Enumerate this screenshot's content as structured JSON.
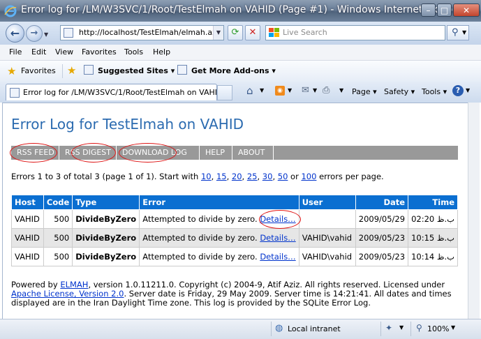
{
  "window": {
    "title": "Error log for /LM/W3SVC/1/Root/TestElmah on VAHID (Page #1) - Windows Internet Explorer",
    "min_label": "–",
    "max_label": "□",
    "close_label": "✕"
  },
  "address": {
    "url": "http://localhost/TestElmah/elmah.axd",
    "search_placeholder": "Live Search"
  },
  "menu": [
    "File",
    "Edit",
    "View",
    "Favorites",
    "Tools",
    "Help"
  ],
  "favorites": {
    "favorites_label": "Favorites",
    "suggested_label": "Suggested Sites ▾",
    "addons_label": "Get More Add-ons ▾"
  },
  "tab": {
    "title": "Error log for /LM/W3SVC/1/Root/TestElmah on VAHI..."
  },
  "commands": {
    "page": "Page ▾",
    "safety": "Safety ▾",
    "tools": "Tools ▾"
  },
  "page": {
    "heading": "Error Log for TestElmah on VAHID",
    "speedbar": [
      "RSS FEED",
      "RSS DIGEST",
      "DOWNLOAD LOG",
      "HELP",
      "ABOUT"
    ],
    "summary_prefix": "Errors 1 to 3 of total 3 (page 1 of 1). Start with ",
    "page_sizes": [
      "10",
      "15",
      "20",
      "25",
      "30",
      "50",
      "100"
    ],
    "summary_or": " or ",
    "summary_suffix": " errors per page.",
    "columns": [
      "Host",
      "Code",
      "Type",
      "Error",
      "User",
      "Date",
      "Time"
    ],
    "rows": [
      {
        "host": "VAHID",
        "code": "500",
        "type": "DivideByZero",
        "error": "Attempted to divide by zero.",
        "details": "Details…",
        "user": "",
        "date": "2009/05/29",
        "time": "02:20 ب.ظ"
      },
      {
        "host": "VAHID",
        "code": "500",
        "type": "DivideByZero",
        "error": "Attempted to divide by zero.",
        "details": "Details…",
        "user": "VAHID\\vahid",
        "date": "2009/05/23",
        "time": "10:15 ب.ظ"
      },
      {
        "host": "VAHID",
        "code": "500",
        "type": "DivideByZero",
        "error": "Attempted to divide by zero.",
        "details": "Details…",
        "user": "VAHID\\vahid",
        "date": "2009/05/23",
        "time": "10:14 ب.ظ"
      }
    ],
    "footer": {
      "powered_by": "Powered by ",
      "elmah_link": "ELMAH",
      "text1": ", version 1.0.11211.0. Copyright (c) 2004-9, Atif Aziz. All rights reserved. Licensed under ",
      "license_link": "Apache License, Version 2.0",
      "text2": ". Server date is Friday, 29 May 2009. Server time is 14:21:41. All dates and times displayed are in the Iran Daylight Time zone. This log is provided by the SQLite Error Log."
    }
  },
  "status": {
    "zone": "Local intranet",
    "zoom": "100%"
  },
  "colors": {
    "heading": "#2b6bb0",
    "table_header": "#0b6fd1",
    "speedbar": "#999999",
    "annotation": "#dd1111"
  }
}
